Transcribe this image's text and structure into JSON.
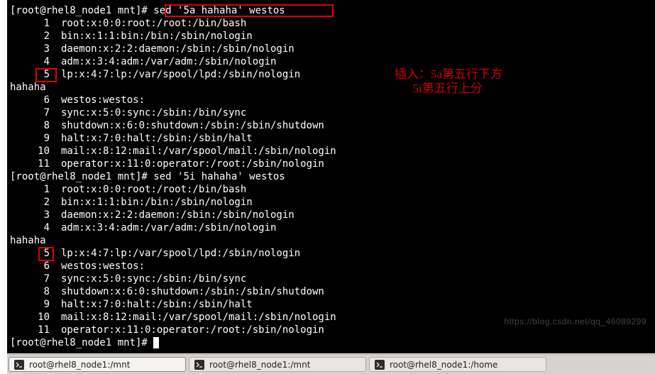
{
  "terminal": {
    "prompt1_prefix": "[root@rhel8_node1 mnt]# ",
    "cmd1": "sed '5a hahaha' westos",
    "out1": [
      {
        "n": "1",
        "t": "root:x:0:0:root:/root:/bin/bash"
      },
      {
        "n": "2",
        "t": "bin:x:1:1:bin:/bin:/sbin/nologin"
      },
      {
        "n": "3",
        "t": "daemon:x:2:2:daemon:/sbin:/sbin/nologin"
      },
      {
        "n": "4",
        "t": "adm:x:3:4:adm:/var/adm:/sbin/nologin"
      },
      {
        "n": "5",
        "t": "lp:x:4:7:lp:/var/spool/lpd:/sbin/nologin"
      }
    ],
    "insert1": "hahaha",
    "out1b": [
      {
        "n": "6",
        "t": "westos:westos:"
      },
      {
        "n": "7",
        "t": "sync:x:5:0:sync:/sbin:/bin/sync"
      },
      {
        "n": "8",
        "t": "shutdown:x:6:0:shutdown:/sbin:/sbin/shutdown"
      },
      {
        "n": "9",
        "t": "halt:x:7:0:halt:/sbin:/sbin/halt"
      },
      {
        "n": "10",
        "t": "mail:x:8:12:mail:/var/spool/mail:/sbin/nologin"
      },
      {
        "n": "11",
        "t": "operator:x:11:0:operator:/root:/sbin/nologin"
      }
    ],
    "prompt2_prefix": "[root@rhel8_node1 mnt]# ",
    "cmd2": "sed '5i hahaha' westos",
    "out2": [
      {
        "n": "1",
        "t": "root:x:0:0:root:/root:/bin/bash"
      },
      {
        "n": "2",
        "t": "bin:x:1:1:bin:/bin:/sbin/nologin"
      },
      {
        "n": "3",
        "t": "daemon:x:2:2:daemon:/sbin:/sbin/nologin"
      },
      {
        "n": "4",
        "t": "adm:x:3:4:adm:/var/adm:/sbin/nologin"
      }
    ],
    "insert2": "hahaha",
    "out2b": [
      {
        "n": "5",
        "t": "lp:x:4:7:lp:/var/spool/lpd:/sbin/nologin"
      },
      {
        "n": "6",
        "t": "westos:westos:"
      },
      {
        "n": "7",
        "t": "sync:x:5:0:sync:/sbin:/bin/sync"
      },
      {
        "n": "8",
        "t": "shutdown:x:6:0:shutdown:/sbin:/sbin/shutdown"
      },
      {
        "n": "9",
        "t": "halt:x:7:0:halt:/sbin:/sbin/halt"
      },
      {
        "n": "10",
        "t": "mail:x:8:12:mail:/var/spool/mail:/sbin/nologin"
      },
      {
        "n": "11",
        "t": "operator:x:11:0:operator:/root:/sbin/nologin"
      }
    ],
    "prompt3_prefix": "[root@rhel8_node1 mnt]# "
  },
  "annotations": {
    "line1": "插入：5a第五行下方",
    "line2": "      5i第五行上分"
  },
  "watermark": "https://blog.csdn.net/qq_46089299",
  "taskbar": {
    "tabs": [
      {
        "label": "root@rhel8_node1:/mnt"
      },
      {
        "label": "root@rhel8_node1:/mnt"
      },
      {
        "label": "root@rhel8_node1:/home"
      }
    ]
  }
}
